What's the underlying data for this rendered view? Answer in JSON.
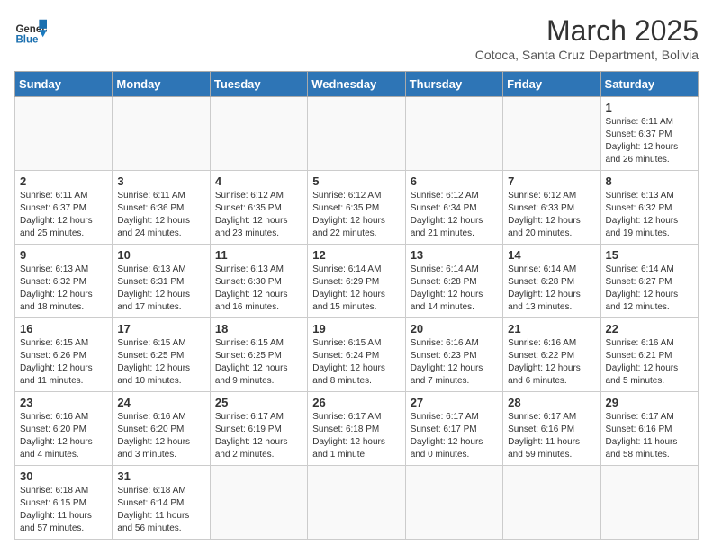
{
  "header": {
    "logo_general": "General",
    "logo_blue": "Blue",
    "month_title": "March 2025",
    "location": "Cotoca, Santa Cruz Department, Bolivia"
  },
  "weekdays": [
    "Sunday",
    "Monday",
    "Tuesday",
    "Wednesday",
    "Thursday",
    "Friday",
    "Saturday"
  ],
  "weeks": [
    [
      {
        "day": "",
        "info": ""
      },
      {
        "day": "",
        "info": ""
      },
      {
        "day": "",
        "info": ""
      },
      {
        "day": "",
        "info": ""
      },
      {
        "day": "",
        "info": ""
      },
      {
        "day": "",
        "info": ""
      },
      {
        "day": "1",
        "info": "Sunrise: 6:11 AM\nSunset: 6:37 PM\nDaylight: 12 hours\nand 26 minutes."
      }
    ],
    [
      {
        "day": "2",
        "info": "Sunrise: 6:11 AM\nSunset: 6:37 PM\nDaylight: 12 hours\nand 25 minutes."
      },
      {
        "day": "3",
        "info": "Sunrise: 6:11 AM\nSunset: 6:36 PM\nDaylight: 12 hours\nand 24 minutes."
      },
      {
        "day": "4",
        "info": "Sunrise: 6:12 AM\nSunset: 6:35 PM\nDaylight: 12 hours\nand 23 minutes."
      },
      {
        "day": "5",
        "info": "Sunrise: 6:12 AM\nSunset: 6:35 PM\nDaylight: 12 hours\nand 22 minutes."
      },
      {
        "day": "6",
        "info": "Sunrise: 6:12 AM\nSunset: 6:34 PM\nDaylight: 12 hours\nand 21 minutes."
      },
      {
        "day": "7",
        "info": "Sunrise: 6:12 AM\nSunset: 6:33 PM\nDaylight: 12 hours\nand 20 minutes."
      },
      {
        "day": "8",
        "info": "Sunrise: 6:13 AM\nSunset: 6:32 PM\nDaylight: 12 hours\nand 19 minutes."
      }
    ],
    [
      {
        "day": "9",
        "info": "Sunrise: 6:13 AM\nSunset: 6:32 PM\nDaylight: 12 hours\nand 18 minutes."
      },
      {
        "day": "10",
        "info": "Sunrise: 6:13 AM\nSunset: 6:31 PM\nDaylight: 12 hours\nand 17 minutes."
      },
      {
        "day": "11",
        "info": "Sunrise: 6:13 AM\nSunset: 6:30 PM\nDaylight: 12 hours\nand 16 minutes."
      },
      {
        "day": "12",
        "info": "Sunrise: 6:14 AM\nSunset: 6:29 PM\nDaylight: 12 hours\nand 15 minutes."
      },
      {
        "day": "13",
        "info": "Sunrise: 6:14 AM\nSunset: 6:28 PM\nDaylight: 12 hours\nand 14 minutes."
      },
      {
        "day": "14",
        "info": "Sunrise: 6:14 AM\nSunset: 6:28 PM\nDaylight: 12 hours\nand 13 minutes."
      },
      {
        "day": "15",
        "info": "Sunrise: 6:14 AM\nSunset: 6:27 PM\nDaylight: 12 hours\nand 12 minutes."
      }
    ],
    [
      {
        "day": "16",
        "info": "Sunrise: 6:15 AM\nSunset: 6:26 PM\nDaylight: 12 hours\nand 11 minutes."
      },
      {
        "day": "17",
        "info": "Sunrise: 6:15 AM\nSunset: 6:25 PM\nDaylight: 12 hours\nand 10 minutes."
      },
      {
        "day": "18",
        "info": "Sunrise: 6:15 AM\nSunset: 6:25 PM\nDaylight: 12 hours\nand 9 minutes."
      },
      {
        "day": "19",
        "info": "Sunrise: 6:15 AM\nSunset: 6:24 PM\nDaylight: 12 hours\nand 8 minutes."
      },
      {
        "day": "20",
        "info": "Sunrise: 6:16 AM\nSunset: 6:23 PM\nDaylight: 12 hours\nand 7 minutes."
      },
      {
        "day": "21",
        "info": "Sunrise: 6:16 AM\nSunset: 6:22 PM\nDaylight: 12 hours\nand 6 minutes."
      },
      {
        "day": "22",
        "info": "Sunrise: 6:16 AM\nSunset: 6:21 PM\nDaylight: 12 hours\nand 5 minutes."
      }
    ],
    [
      {
        "day": "23",
        "info": "Sunrise: 6:16 AM\nSunset: 6:20 PM\nDaylight: 12 hours\nand 4 minutes."
      },
      {
        "day": "24",
        "info": "Sunrise: 6:16 AM\nSunset: 6:20 PM\nDaylight: 12 hours\nand 3 minutes."
      },
      {
        "day": "25",
        "info": "Sunrise: 6:17 AM\nSunset: 6:19 PM\nDaylight: 12 hours\nand 2 minutes."
      },
      {
        "day": "26",
        "info": "Sunrise: 6:17 AM\nSunset: 6:18 PM\nDaylight: 12 hours\nand 1 minute."
      },
      {
        "day": "27",
        "info": "Sunrise: 6:17 AM\nSunset: 6:17 PM\nDaylight: 12 hours\nand 0 minutes."
      },
      {
        "day": "28",
        "info": "Sunrise: 6:17 AM\nSunset: 6:16 PM\nDaylight: 11 hours\nand 59 minutes."
      },
      {
        "day": "29",
        "info": "Sunrise: 6:17 AM\nSunset: 6:16 PM\nDaylight: 11 hours\nand 58 minutes."
      }
    ],
    [
      {
        "day": "30",
        "info": "Sunrise: 6:18 AM\nSunset: 6:15 PM\nDaylight: 11 hours\nand 57 minutes."
      },
      {
        "day": "31",
        "info": "Sunrise: 6:18 AM\nSunset: 6:14 PM\nDaylight: 11 hours\nand 56 minutes."
      },
      {
        "day": "",
        "info": ""
      },
      {
        "day": "",
        "info": ""
      },
      {
        "day": "",
        "info": ""
      },
      {
        "day": "",
        "info": ""
      },
      {
        "day": "",
        "info": ""
      }
    ]
  ]
}
